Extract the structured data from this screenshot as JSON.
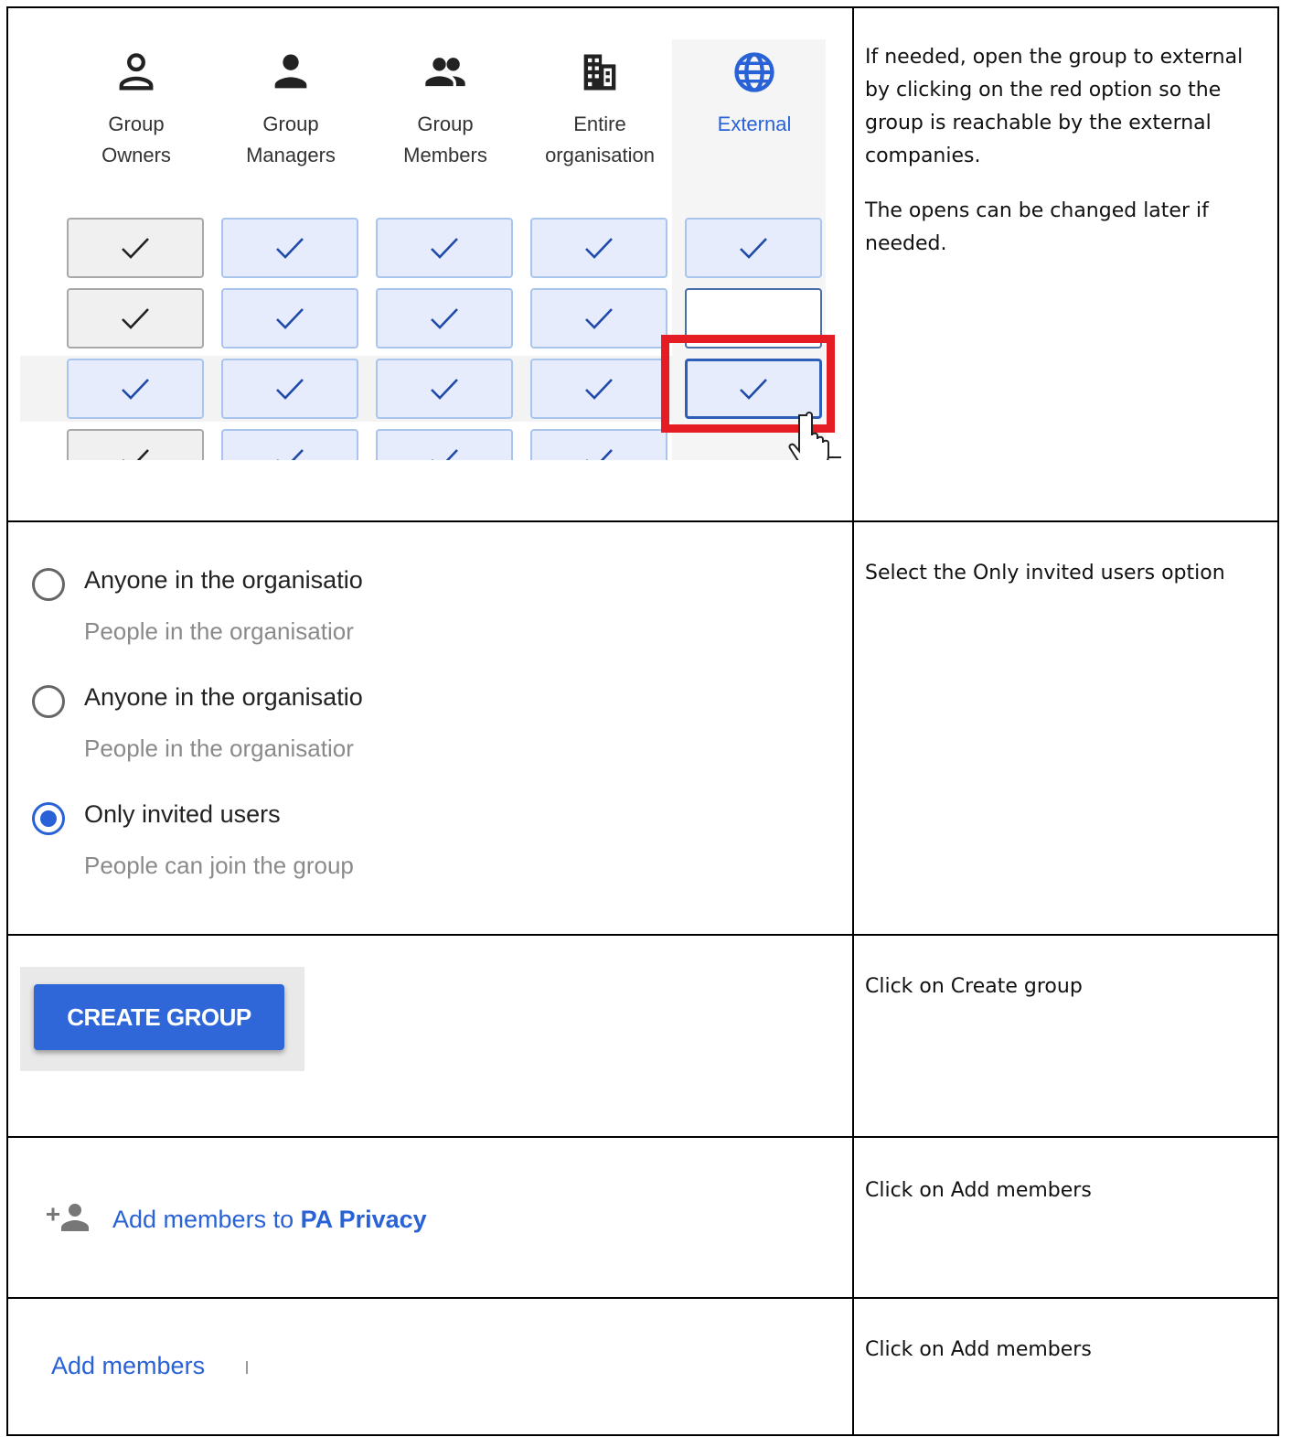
{
  "row1": {
    "columns": [
      {
        "icon": "person-outline-icon",
        "label_line1": "Group",
        "label_line2": "Owners"
      },
      {
        "icon": "person-icon",
        "label_line1": "Group",
        "label_line2": "Managers"
      },
      {
        "icon": "people-icon",
        "label_line1": "Group",
        "label_line2": "Members"
      },
      {
        "icon": "building-icon",
        "label_line1": "Entire",
        "label_line2": "organisation"
      },
      {
        "icon": "globe-icon",
        "label_line1": "External",
        "label_line2": ""
      }
    ],
    "instruction_p1": "If needed, open the group to external by clicking on the red option so the group is reachable by the external companies.",
    "instruction_p2": "The opens can be changed later if needed."
  },
  "row2": {
    "options": [
      {
        "title": "Anyone in the organisatio",
        "desc": "People in the organisatior",
        "selected": false
      },
      {
        "title": "Anyone in the organisatio",
        "desc": "People in the organisatior",
        "selected": false
      },
      {
        "title": "Only invited users",
        "desc": "People can join the group",
        "selected": true
      }
    ],
    "instruction": "Select the Only invited users option"
  },
  "row3": {
    "button_label": "CREATE GROUP",
    "instruction": "Click on Create group"
  },
  "row4": {
    "link_prefix": "Add members to ",
    "link_group": "PA Privacy",
    "instruction": "Click on Add members"
  },
  "row5": {
    "link_label": "Add members",
    "instruction": "Click on Add members"
  },
  "colors": {
    "accent_blue": "#2962d6",
    "highlight_red": "#e51c23"
  }
}
